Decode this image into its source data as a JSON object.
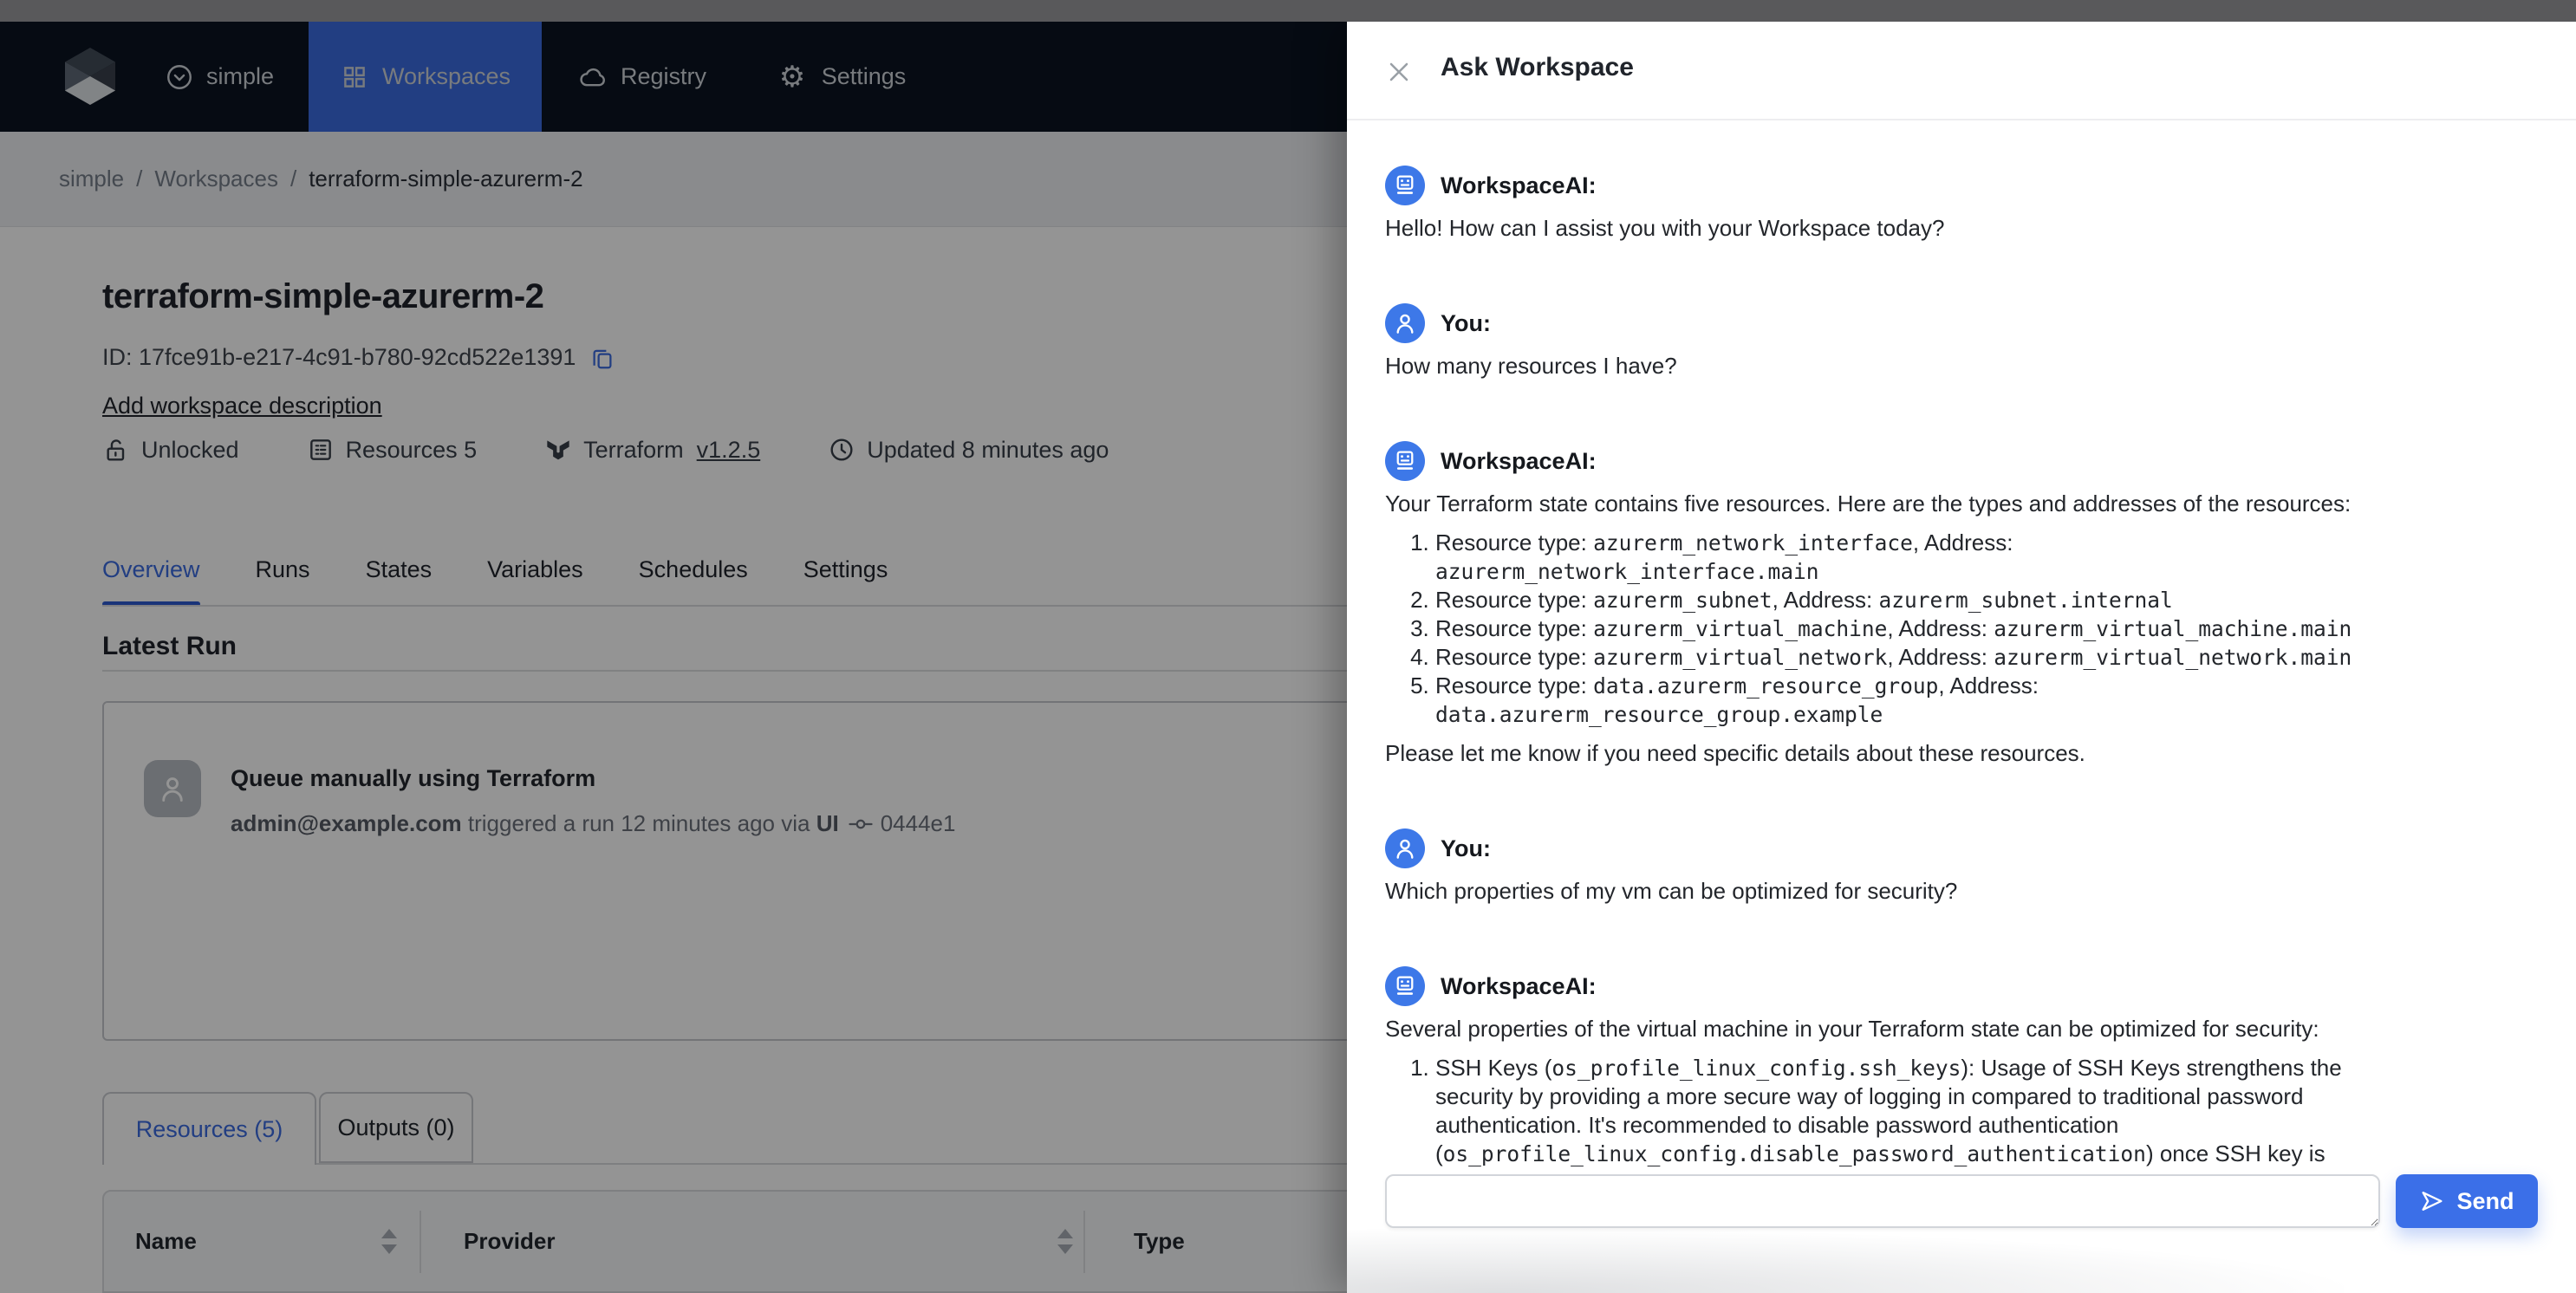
{
  "colors": {
    "accent": "#3b6fe8",
    "nav_active_bg": "#3b6be0",
    "nav_bg": "#0b1322",
    "top_strip": "#59595b",
    "dim_overlay": "rgba(0,0,0,0.42)"
  },
  "nav": {
    "brand": "simple",
    "items": [
      {
        "label": "Workspaces",
        "icon": "grid-icon",
        "active": true
      },
      {
        "label": "Registry",
        "icon": "cloud-icon",
        "active": false
      },
      {
        "label": "Settings",
        "icon": "gear-icon",
        "active": false
      }
    ]
  },
  "breadcrumb": {
    "separator": "/",
    "links": [
      "simple",
      "Workspaces"
    ],
    "current": "terraform-simple-azurerm-2"
  },
  "workspace": {
    "title": "terraform-simple-azurerm-2",
    "id": "ID: 17fce91b-e217-4c91-b780-92cd522e1391",
    "add_description": "Add workspace description",
    "meta": [
      {
        "icon": "unlock-icon",
        "label": "Unlocked"
      },
      {
        "icon": "resources-icon",
        "label": "Resources 5"
      },
      {
        "icon": "terraform-icon",
        "label": "Terraform",
        "link": "v1.2.5"
      },
      {
        "icon": "clock-icon",
        "label": "Updated 8 minutes ago"
      }
    ]
  },
  "workspace_tabs": {
    "active": "Overview",
    "items": [
      "Overview",
      "Runs",
      "States",
      "Variables",
      "Schedules",
      "Settings"
    ]
  },
  "latest_run": {
    "heading": "Latest Run",
    "title": "Queue manually using Terraform",
    "actor": "admin@example.com",
    "action": " triggered a run 12 minutes ago via ",
    "via": "UI",
    "commit": "0444e1"
  },
  "resource_tabs": {
    "active": "Resources (5)",
    "items": [
      "Resources (5)",
      "Outputs (0)"
    ]
  },
  "resources_table": {
    "columns": [
      {
        "label": "Name",
        "sortable": true
      },
      {
        "label": "Provider",
        "sortable": true
      },
      {
        "label": "Type",
        "sortable": false
      }
    ]
  },
  "ask_panel": {
    "title": "Ask Workspace",
    "close_icon": "close-icon",
    "send_label": "Send",
    "input_value": "",
    "input_placeholder": "",
    "messages": [
      {
        "sender": "ai",
        "label": "WorkspaceAI:",
        "blocks": [
          {
            "type": "p",
            "lines": [
              [
                {
                  "code": false,
                  "s": "Hello! How can I assist you with your Workspace today?"
                }
              ]
            ]
          }
        ]
      },
      {
        "sender": "user",
        "label": "You:",
        "blocks": [
          {
            "type": "p",
            "lines": [
              [
                {
                  "code": false,
                  "s": "How many resources I have?"
                }
              ]
            ]
          }
        ]
      },
      {
        "sender": "ai",
        "label": "WorkspaceAI:",
        "blocks": [
          {
            "type": "p",
            "lines": [
              [
                {
                  "code": false,
                  "s": "Your Terraform state contains five resources. Here are the types and addresses of the resources:"
                }
              ]
            ]
          },
          {
            "type": "ol",
            "items": [
              {
                "lines": [
                  [
                    {
                      "code": false,
                      "s": "Resource type: "
                    },
                    {
                      "code": true,
                      "s": "azurerm_network_interface"
                    },
                    {
                      "code": false,
                      "s": ", Address:"
                    }
                  ],
                  [
                    {
                      "code": true,
                      "s": "azurerm_network_interface.main"
                    }
                  ]
                ]
              },
              {
                "lines": [
                  [
                    {
                      "code": false,
                      "s": "Resource type: "
                    },
                    {
                      "code": true,
                      "s": "azurerm_subnet"
                    },
                    {
                      "code": false,
                      "s": ", Address: "
                    },
                    {
                      "code": true,
                      "s": "azurerm_subnet.internal"
                    }
                  ]
                ]
              },
              {
                "lines": [
                  [
                    {
                      "code": false,
                      "s": "Resource type: "
                    },
                    {
                      "code": true,
                      "s": "azurerm_virtual_machine"
                    },
                    {
                      "code": false,
                      "s": ", Address: "
                    },
                    {
                      "code": true,
                      "s": "azurerm_virtual_machine.main"
                    }
                  ]
                ]
              },
              {
                "lines": [
                  [
                    {
                      "code": false,
                      "s": "Resource type: "
                    },
                    {
                      "code": true,
                      "s": "azurerm_virtual_network"
                    },
                    {
                      "code": false,
                      "s": ", Address: "
                    },
                    {
                      "code": true,
                      "s": "azurerm_virtual_network.main"
                    }
                  ]
                ]
              },
              {
                "lines": [
                  [
                    {
                      "code": false,
                      "s": "Resource type: "
                    },
                    {
                      "code": true,
                      "s": "data.azurerm_resource_group"
                    },
                    {
                      "code": false,
                      "s": ", Address:"
                    }
                  ],
                  [
                    {
                      "code": true,
                      "s": "data.azurerm_resource_group.example"
                    }
                  ]
                ]
              }
            ]
          },
          {
            "type": "p",
            "lines": [
              [
                {
                  "code": false,
                  "s": "Please let me know if you need specific details about these resources."
                }
              ]
            ]
          }
        ]
      },
      {
        "sender": "user",
        "label": "You:",
        "blocks": [
          {
            "type": "p",
            "lines": [
              [
                {
                  "code": false,
                  "s": "Which properties of my vm can be optimized for security?"
                }
              ]
            ]
          }
        ]
      },
      {
        "sender": "ai",
        "label": "WorkspaceAI:",
        "blocks": [
          {
            "type": "p",
            "lines": [
              [
                {
                  "code": false,
                  "s": "Several properties of the virtual machine in your Terraform state can be optimized for security:"
                }
              ]
            ]
          },
          {
            "type": "ol",
            "items": [
              {
                "lines": [
                  [
                    {
                      "code": false,
                      "s": "SSH Keys ("
                    },
                    {
                      "code": true,
                      "s": "os_profile_linux_config.ssh_keys"
                    },
                    {
                      "code": false,
                      "s": "): Usage of SSH Keys strengthens the"
                    }
                  ],
                  [
                    {
                      "code": false,
                      "s": "security by providing a more secure way of logging in compared to traditional password"
                    }
                  ],
                  [
                    {
                      "code": false,
                      "s": "authentication. It's recommended to disable password authentication"
                    }
                  ],
                  [
                    {
                      "code": false,
                      "s": "("
                    },
                    {
                      "code": true,
                      "s": "os_profile_linux_config.disable_password_authentication"
                    },
                    {
                      "code": false,
                      "s": ") once SSH key is"
                    }
                  ]
                ]
              }
            ]
          }
        ]
      }
    ]
  }
}
